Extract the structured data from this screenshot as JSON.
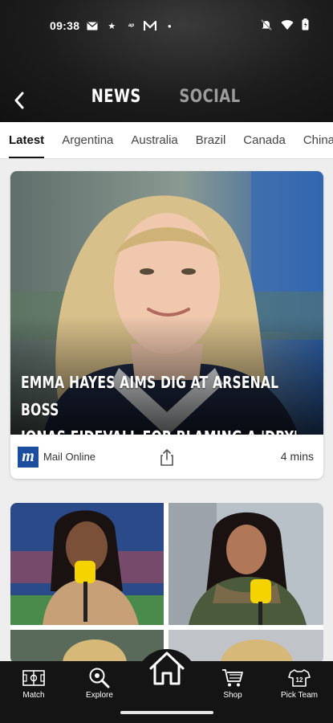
{
  "status_bar": {
    "time": "09:38",
    "icons": [
      "mail-icon",
      "star-icon",
      "sky-sports-icon",
      "app-m-icon",
      "dot-icon",
      "mute-icon",
      "wifi-icon",
      "battery-icon"
    ]
  },
  "header": {
    "tabs": [
      {
        "label": "NEWS",
        "active": true
      },
      {
        "label": "SOCIAL",
        "active": false
      }
    ]
  },
  "categories": [
    {
      "label": "Latest",
      "active": true
    },
    {
      "label": "Argentina"
    },
    {
      "label": "Australia"
    },
    {
      "label": "Brazil"
    },
    {
      "label": "Canada"
    },
    {
      "label": "China"
    }
  ],
  "article": {
    "headline_line1": "EMMA HAYES AIMS DIG AT ARSENAL BOSS",
    "headline_line2": "JONAS EIDEVALL FOR BLAMING A 'DRY' P...",
    "source_name": "Mail Online",
    "source_logo_letter": "m",
    "time_ago": "4 mins"
  },
  "bottom_nav": {
    "items": [
      {
        "label": "Match",
        "icon": "pitch-icon"
      },
      {
        "label": "Explore",
        "icon": "search-ball-icon"
      },
      {
        "label": "",
        "icon": "home-icon"
      },
      {
        "label": "Shop",
        "icon": "cart-icon"
      },
      {
        "label": "Pick Team",
        "icon": "shirt-icon"
      }
    ]
  },
  "colors": {
    "header_bg": "#1c1c1c",
    "accent_text": "#111111",
    "source_logo_bg": "#1b4e9e",
    "nav_bg": "#141414"
  }
}
